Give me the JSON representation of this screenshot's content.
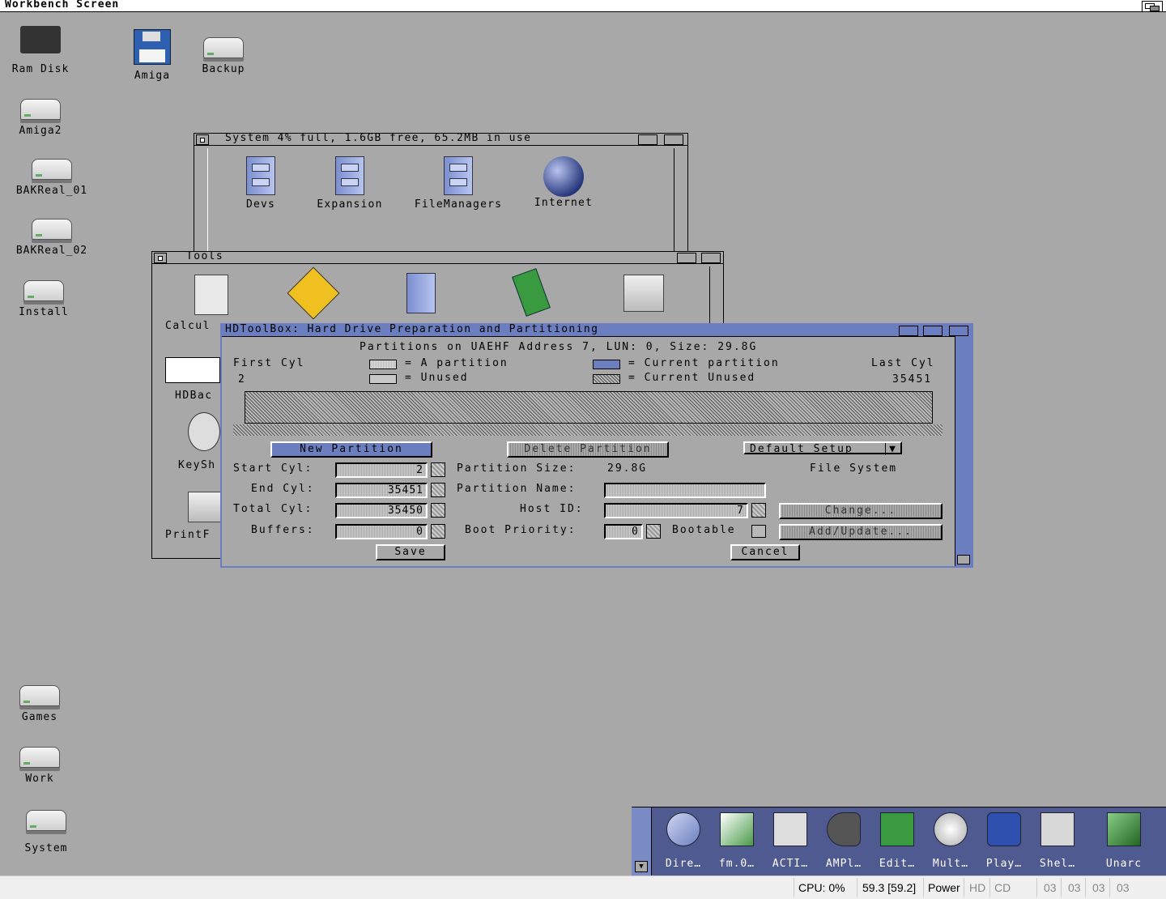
{
  "screen": {
    "title": "Workbench Screen"
  },
  "desktop_icons": [
    {
      "label": "Ram Disk"
    },
    {
      "label": "Amiga"
    },
    {
      "label": "Backup"
    },
    {
      "label": "Amiga2"
    },
    {
      "label": "BAKReal_01"
    },
    {
      "label": "BAKReal_02"
    },
    {
      "label": "Install"
    },
    {
      "label": "Games"
    },
    {
      "label": "Work"
    },
    {
      "label": "System"
    }
  ],
  "system_window": {
    "title": "System  4% full, 1.6GB free, 65.2MB in use",
    "items": [
      "Devs",
      "Expansion",
      "FileManagers",
      "Internet"
    ]
  },
  "tools_window": {
    "title": "Tools",
    "items": [
      "Calcul",
      "HDBac",
      "KeySh",
      "PrintF"
    ]
  },
  "hdtoolbox": {
    "title": "HDToolBox: Hard Drive Preparation and Partitioning",
    "header": "Partitions on UAEHF Address 7, LUN: 0, Size: 29.8G",
    "first_cyl_label": "First Cyl",
    "first_cyl_value": "2",
    "last_cyl_label": "Last Cyl",
    "last_cyl_value": "35451",
    "legend_a_partition": "= A partition",
    "legend_unused": "= Unused",
    "legend_current_partition": "= Current partition",
    "legend_current_unused": "= Current Unused",
    "new_partition": "New Partition",
    "delete_partition": "Delete Partition",
    "default_setup": "Default Setup",
    "start_cyl_label": "Start Cyl:",
    "start_cyl_value": "2",
    "end_cyl_label": "End Cyl:",
    "end_cyl_value": "35451",
    "total_cyl_label": "Total Cyl:",
    "total_cyl_value": "35450",
    "buffers_label": "Buffers:",
    "buffers_value": "0",
    "partition_size_label": "Partition Size:",
    "partition_size_value": "29.8G",
    "partition_name_label": "Partition Name:",
    "partition_name_value": "",
    "host_id_label": "Host ID:",
    "host_id_value": "7",
    "boot_priority_label": "Boot Priority:",
    "boot_priority_value": "0",
    "bootable_label": "Bootable",
    "file_system_label": "File System",
    "change_button": "Change...",
    "add_update_button": "Add/Update...",
    "save_button": "Save",
    "cancel_button": "Cancel"
  },
  "dock": {
    "items": [
      "Dire…",
      "fm.0…",
      "ACTI…",
      "AMPl…",
      "Edit…",
      "Mult…",
      "Play…",
      "Shel…",
      "Unarc"
    ]
  },
  "status_bar": {
    "cpu": "CPU: 0%",
    "fps": "59.3 [59.2]",
    "power": "Power",
    "hd": "HD",
    "cd": "CD",
    "df": [
      "03",
      "03",
      "03",
      "03"
    ]
  },
  "colors": {
    "desktop": "#a8a8a8",
    "accent": "#6b7fc0",
    "dock": "#4f5a90"
  }
}
